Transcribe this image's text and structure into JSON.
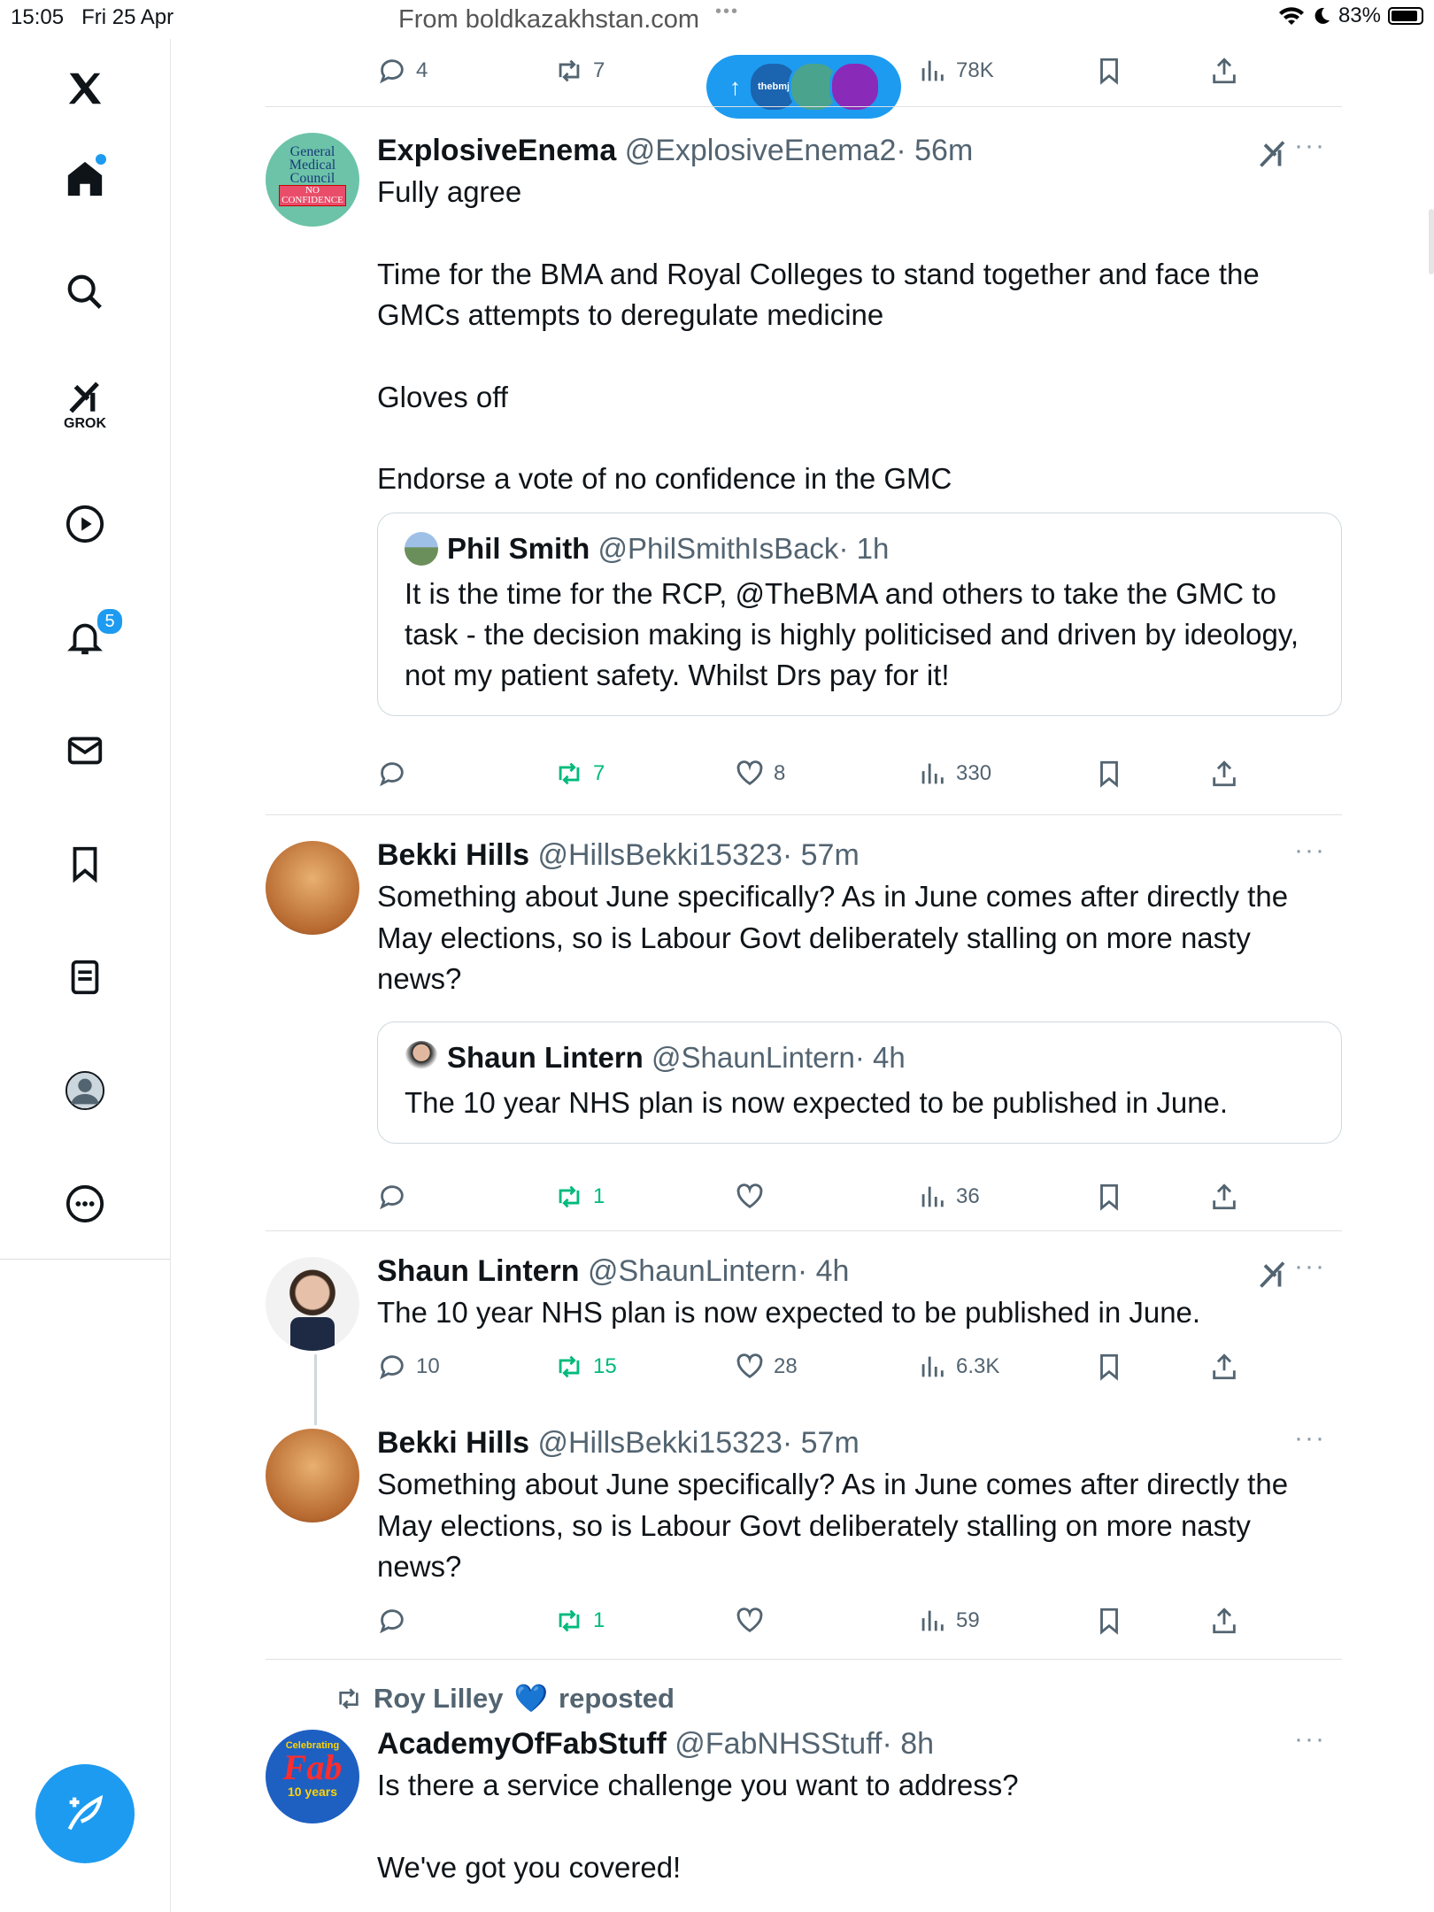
{
  "status_bar": {
    "time": "15:05",
    "date": "Fri 25 Apr",
    "url": "From boldkazakhstan.com",
    "battery": "83%"
  },
  "sidebar": {
    "items": [
      {
        "name": "home",
        "icon": "home-icon"
      },
      {
        "name": "search",
        "icon": "search-icon"
      },
      {
        "name": "grok",
        "icon": "grok-icon",
        "label": "GROK"
      },
      {
        "name": "video",
        "icon": "play-icon"
      },
      {
        "name": "notifications",
        "icon": "bell-icon",
        "badge": "5"
      },
      {
        "name": "messages",
        "icon": "mail-icon"
      },
      {
        "name": "bookmarks",
        "icon": "bookmark-icon"
      },
      {
        "name": "lists",
        "icon": "list-icon"
      },
      {
        "name": "profile",
        "icon": "avatar-icon"
      },
      {
        "name": "more",
        "icon": "more-icon"
      }
    ]
  },
  "new_posts_pill": {
    "arrow": "↑",
    "avatars": [
      "thebmj",
      "",
      ""
    ]
  },
  "top_actions": {
    "replies": "4",
    "reposts": "7",
    "views": "78K"
  },
  "tweets": [
    {
      "name": "ExplosiveEnema",
      "handle": "@ExplosiveEnema2",
      "time": "· 56m",
      "avatar_text": [
        "General",
        "Medical",
        "Council",
        "NO",
        "CONFIDENCE"
      ],
      "lines": [
        "Fully agree",
        "Time for the BMA and Royal Colleges to stand together and face the GMCs attempts to deregulate medicine",
        "Gloves off",
        "Endorse a vote of no confidence in the GMC"
      ],
      "quote": {
        "name": "Phil Smith",
        "handle": "@PhilSmithIsBack",
        "time": "· 1h",
        "text": "It is the time for the RCP, @TheBMA and others to take the GMC to task - the decision making is highly politicised and driven by ideology, not my patient safety. Whilst Drs pay for it!"
      },
      "actions": {
        "replies": "",
        "reposts": "7",
        "likes": "8",
        "views": "330"
      }
    },
    {
      "name": "Bekki Hills",
      "handle": "@HillsBekki15323",
      "time": "· 57m",
      "text": "Something about June specifically? As in June comes after directly the May elections, so is Labour Govt deliberately stalling on more nasty news?",
      "quote": {
        "name": "Shaun Lintern",
        "handle": "@ShaunLintern",
        "time": "· 4h",
        "text": "The 10 year NHS plan is now expected to be published in June."
      },
      "actions": {
        "replies": "",
        "reposts": "1",
        "likes": "",
        "views": "36"
      }
    },
    {
      "name": "Shaun Lintern",
      "handle": "@ShaunLintern",
      "time": "· 4h",
      "text": "The 10 year NHS plan is now expected to be published in June.",
      "actions": {
        "replies": "10",
        "reposts": "15",
        "likes": "28",
        "views": "6.3K"
      }
    },
    {
      "name": "Bekki Hills",
      "handle": "@HillsBekki15323",
      "time": "· 57m",
      "text": "Something about June specifically? As in June comes after directly the May elections, so is Labour Govt deliberately stalling on more nasty news?",
      "actions": {
        "replies": "",
        "reposts": "1",
        "likes": "",
        "views": "59"
      }
    },
    {
      "reposted_by": "Roy Lilley",
      "reposted_label": "reposted",
      "reposted_emoji": "💙",
      "name": "AcademyOfFabStuff",
      "handle": "@FabNHSStuff",
      "time": "· 8h",
      "avatar_text": [
        "Celebrating",
        "Fab",
        "10 years"
      ],
      "lines": [
        "Is there a service challenge you want to address?",
        "We've got you covered!"
      ]
    }
  ]
}
